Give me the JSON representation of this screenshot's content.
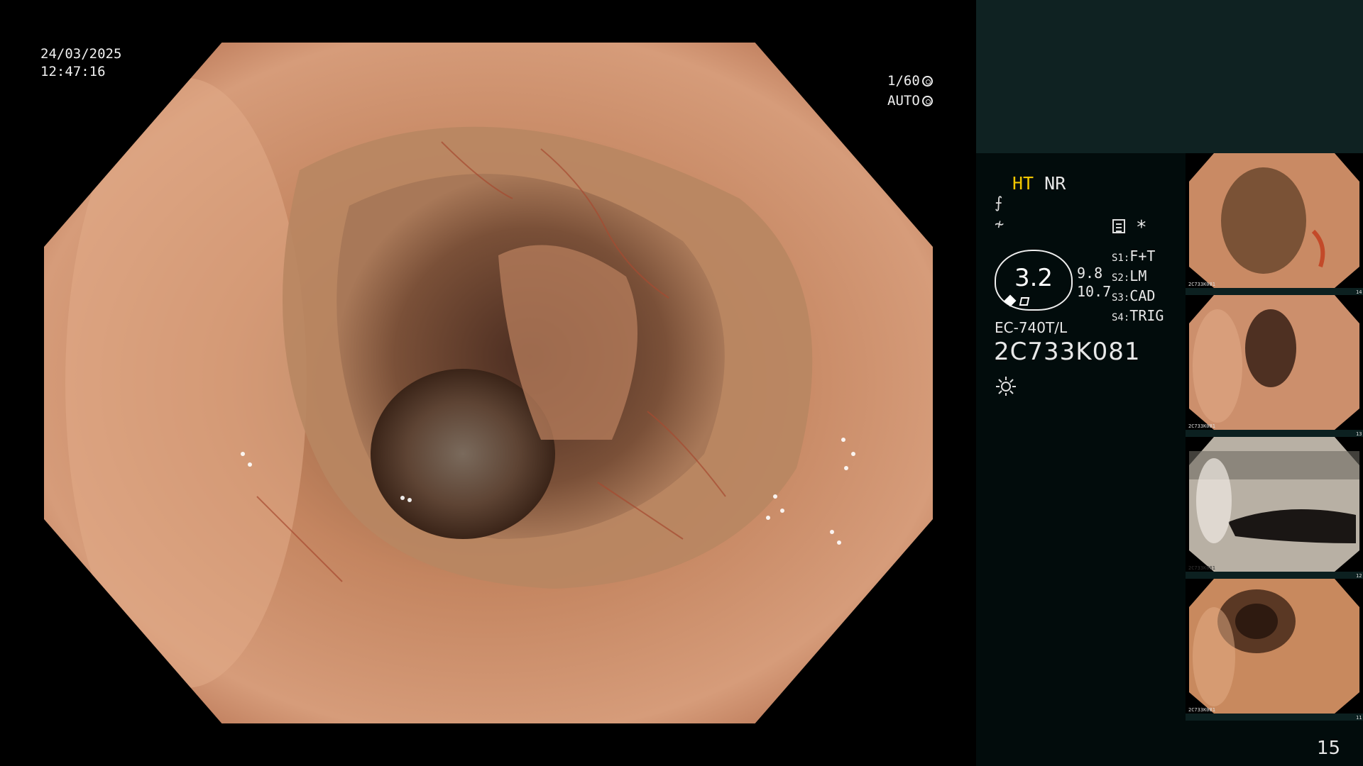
{
  "overlay": {
    "date": "24/03/2025",
    "time": "12:47:16",
    "shutter": "1/60",
    "iris": "AUTO"
  },
  "status": {
    "ht": "HT",
    "nr": "NR",
    "enhancement": "3.2",
    "val_upper": "9.8",
    "val_lower": "10.7",
    "star": "*",
    "switches": [
      {
        "key": "S1:",
        "value": "F+T"
      },
      {
        "key": "S2:",
        "value": "LM"
      },
      {
        "key": "S3:",
        "value": "CAD"
      },
      {
        "key": "S4:",
        "value": "TRIG"
      }
    ],
    "model": "EC-740T/L",
    "serial": "2C733K081"
  },
  "thumbnails": [
    {
      "index": "14",
      "serial": "2C733K081"
    },
    {
      "index": "13",
      "serial": "2C733K081"
    },
    {
      "index": "12",
      "serial": "2C733K081"
    },
    {
      "index": "11",
      "serial": "2C733K081"
    }
  ],
  "page_number": "15",
  "colors": {
    "panel_bg": "#020c0c",
    "panel_top_bg": "#0f2222",
    "highlight": "#f2c700"
  }
}
